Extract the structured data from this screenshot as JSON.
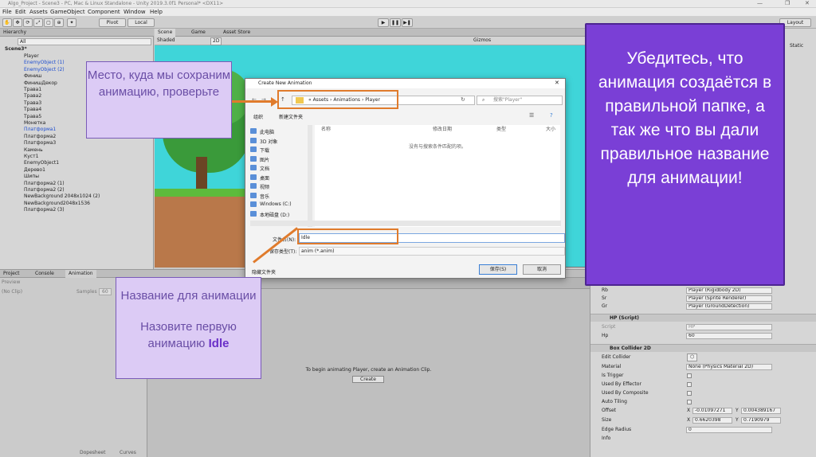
{
  "window": {
    "title": "Algo_Project - Scene3 - PC, Mac & Linux Standalone - Unity 2019.3.0f1 Personal* <DX11>"
  },
  "menu": [
    "File",
    "Edit",
    "Assets",
    "GameObject",
    "Component",
    "Window",
    "Help"
  ],
  "toolbar": {
    "pivot": "Pivot",
    "local": "Local",
    "layout": "Layout",
    "play_icon": "play-icon"
  },
  "hierarchy": {
    "tab": "Hierarchy",
    "search": "All",
    "scene": "Scene3*",
    "items": [
      {
        "label": "Player",
        "color": "#222222"
      },
      {
        "label": "EnemyObject (1)",
        "color": "#1f4fd0"
      },
      {
        "label": "EnemyObject (2)",
        "color": "#1f4fd0"
      },
      {
        "label": "Финиш",
        "color": "#222222"
      },
      {
        "label": "ФинишДекор",
        "color": "#222222"
      },
      {
        "label": "Трава1",
        "color": "#222222"
      },
      {
        "label": "Трава2",
        "color": "#222222"
      },
      {
        "label": "Трава3",
        "color": "#222222"
      },
      {
        "label": "Трава4",
        "color": "#222222"
      },
      {
        "label": "Трава5",
        "color": "#222222"
      },
      {
        "label": "Монетка",
        "color": "#222222"
      },
      {
        "label": "Платформа1",
        "color": "#1f4fd0"
      },
      {
        "label": "Платформа2",
        "color": "#222222"
      },
      {
        "label": "Платформа3",
        "color": "#222222"
      },
      {
        "label": "Камень",
        "color": "#222222"
      },
      {
        "label": "Куст1",
        "color": "#222222"
      },
      {
        "label": "EnemyObject1",
        "color": "#222222"
      },
      {
        "label": "Дерево1",
        "color": "#222222"
      },
      {
        "label": "Шипы",
        "color": "#222222"
      },
      {
        "label": "Платформа2 (1)",
        "color": "#222222"
      },
      {
        "label": "Платформа2 (2)",
        "color": "#222222"
      },
      {
        "label": "NewBackground 2048x1024 (2)",
        "color": "#222222"
      },
      {
        "label": "NewBackground2048x1536",
        "color": "#222222"
      },
      {
        "label": "Платформа2 (3)",
        "color": "#222222"
      }
    ]
  },
  "scene": {
    "tabs": [
      "Scene",
      "Game",
      "Asset Store"
    ],
    "shading": "Shaded",
    "mode2d": "2D",
    "gizmos": "Gizmos"
  },
  "bottom": {
    "tabs": [
      "Project",
      "Console",
      "Animation"
    ],
    "preview": "Preview",
    "clip": "(No Clip)",
    "samples_label": "Samples",
    "samples_value": "60",
    "message": "To begin animating Player, create an Animation Clip.",
    "create_btn": "Create",
    "dopesheet": "Dopesheet",
    "curves": "Curves"
  },
  "inspector": {
    "rows": [
      {
        "label": "Rb",
        "value": "Player (Rigidbody 2D)"
      },
      {
        "label": "Sr",
        "value": "Player (Sprite Renderer)"
      },
      {
        "label": "Gr",
        "value": "Player (GroundDetection)"
      }
    ],
    "hp_header": "HP (Script)",
    "script_label": "Script",
    "script_value": "HP",
    "hp_label": "Hp",
    "hp_value": "60",
    "box_header": "Box Collider 2D",
    "edit_collider": "Edit Collider",
    "material_label": "Material",
    "material_value": "None (Physics Material 2D)",
    "is_trigger": "Is Trigger",
    "used_effector": "Used By Effector",
    "used_composite": "Used By Composite",
    "auto_tiling": "Auto Tiling",
    "offset_label": "Offset",
    "offset_x": "-0.01097271",
    "offset_y": "0.004389167",
    "size_label": "Size",
    "size_x": "0.6620398",
    "size_y": "0.7190979",
    "edge_label": "Edge Radius",
    "edge_value": "0",
    "info": "Info",
    "static_label": "Static"
  },
  "dialog": {
    "title": "Create New Animation",
    "path": [
      "Assets",
      "Animations",
      "Player"
    ],
    "search_placeholder": "搜索\"Player\"",
    "organize": "组织",
    "new_folder": "新建文件夹",
    "sidebar": [
      "此电脑",
      "3D 对象",
      "下载",
      "图片",
      "文档",
      "桌面",
      "视频",
      "音乐",
      "Windows (C:)",
      "本地磁盘 (D:)"
    ],
    "col_name": "名称",
    "col_date": "修改日期",
    "col_type": "类型",
    "col_size": "大小",
    "empty_msg": "没有与搜索条件匹配的项。",
    "filename_label": "文件名(N):",
    "filename_value": "Idle",
    "filetype_label": "保存类型(T):",
    "filetype_value": "anim (*.anim)",
    "hide_folders": "隐藏文件夹",
    "save": "保存(S)",
    "cancel": "取消"
  },
  "annotations": {
    "folder_note": "Место, куда мы сохраним анимацию, проверьте",
    "name_note_line1": "Название для анимации",
    "name_note_line2": "Назовите первую анимацию",
    "name_note_bold": "Idle",
    "big_note": "Убедитесь, что анимация создаётся в правильной папке, а так же что вы дали правильное название для анимации!"
  },
  "colors": {
    "accent_orange": "#e07b2c",
    "note_purple_bg": "#dccbf5",
    "big_note_bg": "#7a3fd6",
    "scene_sky": "#3fd5d9"
  }
}
